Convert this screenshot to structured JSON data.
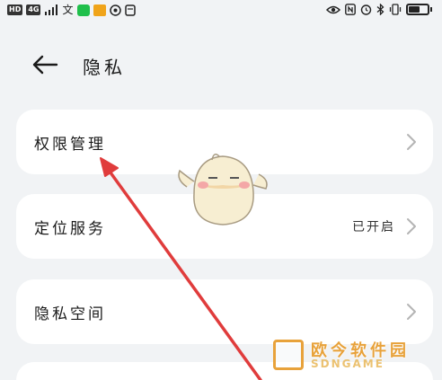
{
  "status_bar": {
    "chips": [
      "HD",
      "4G"
    ],
    "left_glyphs": [
      "文"
    ],
    "right_icons": [
      "eye-icon",
      "nfc-icon",
      "alarm-icon",
      "bluetooth-icon",
      "vibrate-icon",
      "battery-icon"
    ]
  },
  "header": {
    "title": "隐私",
    "back_icon": "arrow-left-icon"
  },
  "menu": {
    "items": [
      {
        "label": "权限管理",
        "value": ""
      },
      {
        "label": "定位服务",
        "value": "已开启"
      },
      {
        "label": "隐私空间",
        "value": ""
      }
    ]
  },
  "watermark": {
    "text": "欧今软件园",
    "sub": "SDNGAME"
  },
  "colors": {
    "background": "#f1f3f5",
    "card": "#ffffff",
    "annotation_arrow": "#e03c3c",
    "watermark": "#e8a23b"
  }
}
